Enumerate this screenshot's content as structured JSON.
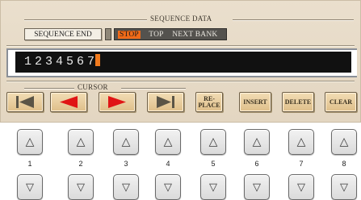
{
  "sequence_data": {
    "group_title": "SEQUENCE DATA",
    "end_label": "SEQUENCE END",
    "end_options": [
      {
        "label": "STOP",
        "selected": true
      },
      {
        "label": "TOP",
        "selected": false
      },
      {
        "label": "NEXT BANK",
        "selected": false
      }
    ],
    "sequence_value": "1234567"
  },
  "cursor": {
    "group_title": "CURSOR",
    "buttons": [
      {
        "name": "first",
        "icon": "skip-first-icon"
      },
      {
        "name": "left",
        "icon": "arrow-left-icon"
      },
      {
        "name": "right",
        "icon": "arrow-right-icon"
      },
      {
        "name": "last",
        "icon": "skip-last-icon"
      }
    ],
    "replace_label_line1": "RE-",
    "replace_label_line2": "PLACE",
    "insert_label": "INSERT",
    "delete_label": "DELETE",
    "clear_label": "CLEAR"
  },
  "hardware_buttons": {
    "up_glyph": "△",
    "down_glyph": "▽",
    "numbers": [
      "1",
      "2",
      "3",
      "4",
      "5",
      "6",
      "7",
      "8"
    ]
  },
  "colors": {
    "selected_option": "#f06a18",
    "cursor_arrows": "#e01515",
    "caret": "#f07a1e",
    "screen_bg": "#e3d6c1"
  }
}
